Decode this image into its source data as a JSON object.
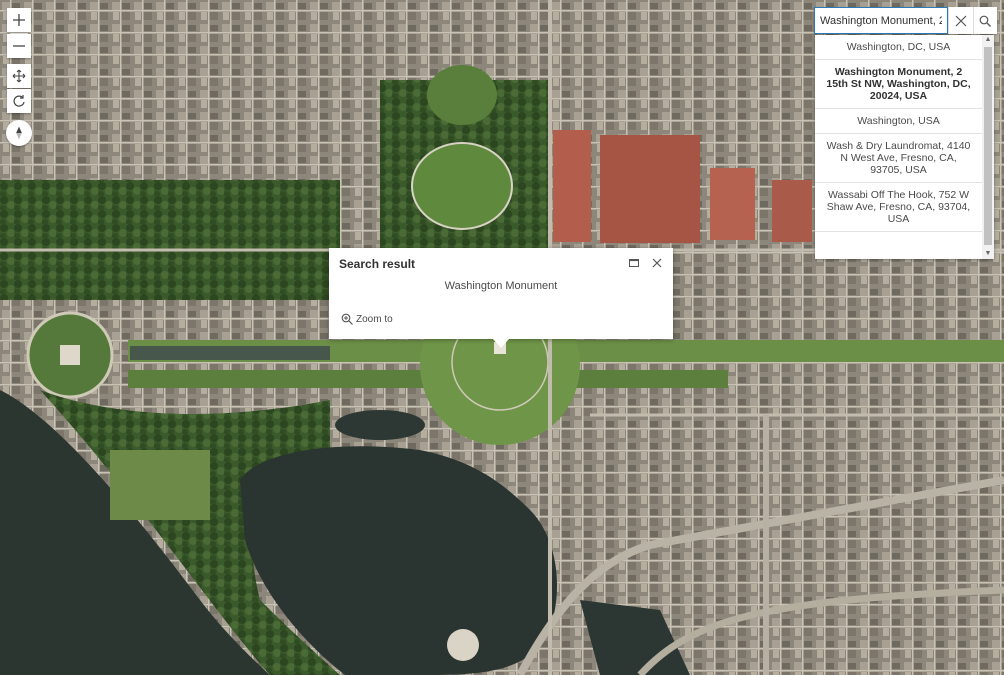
{
  "map": {
    "basemap": "satellite imagery of the National Mall, Washington DC",
    "colors": {
      "water": "#2b3631",
      "grass": "#5e7a3f",
      "trees": "#2f4a24",
      "urban": "#8a8478",
      "road": "#b8b2a6"
    }
  },
  "controls": {
    "zoom_in_icon": "plus-icon",
    "zoom_out_icon": "minus-icon",
    "pan_icon": "move-arrows-icon",
    "rotate_icon": "rotate-icon",
    "compass_icon": "compass-icon"
  },
  "search": {
    "value": "Washington Monument, 2",
    "clear_icon": "close-icon",
    "submit_icon": "search-icon",
    "accent": "#2a7ab7",
    "suggestions": [
      "Washington, DC, USA",
      "Washington Monument, 2 15th St NW, Washington, DC, 20024, USA",
      "Washington, USA",
      "Wash & Dry Laundromat, 4140 N West Ave, Fresno, CA, 93705, USA",
      "Wassabi Off The Hook, 752 W Shaw Ave, Fresno, CA, 93704, USA"
    ]
  },
  "popup": {
    "title": "Search result",
    "content": "Washington Monument",
    "zoom_label": "Zoom to",
    "dock_icon": "dock-icon",
    "close_icon": "close-icon"
  }
}
